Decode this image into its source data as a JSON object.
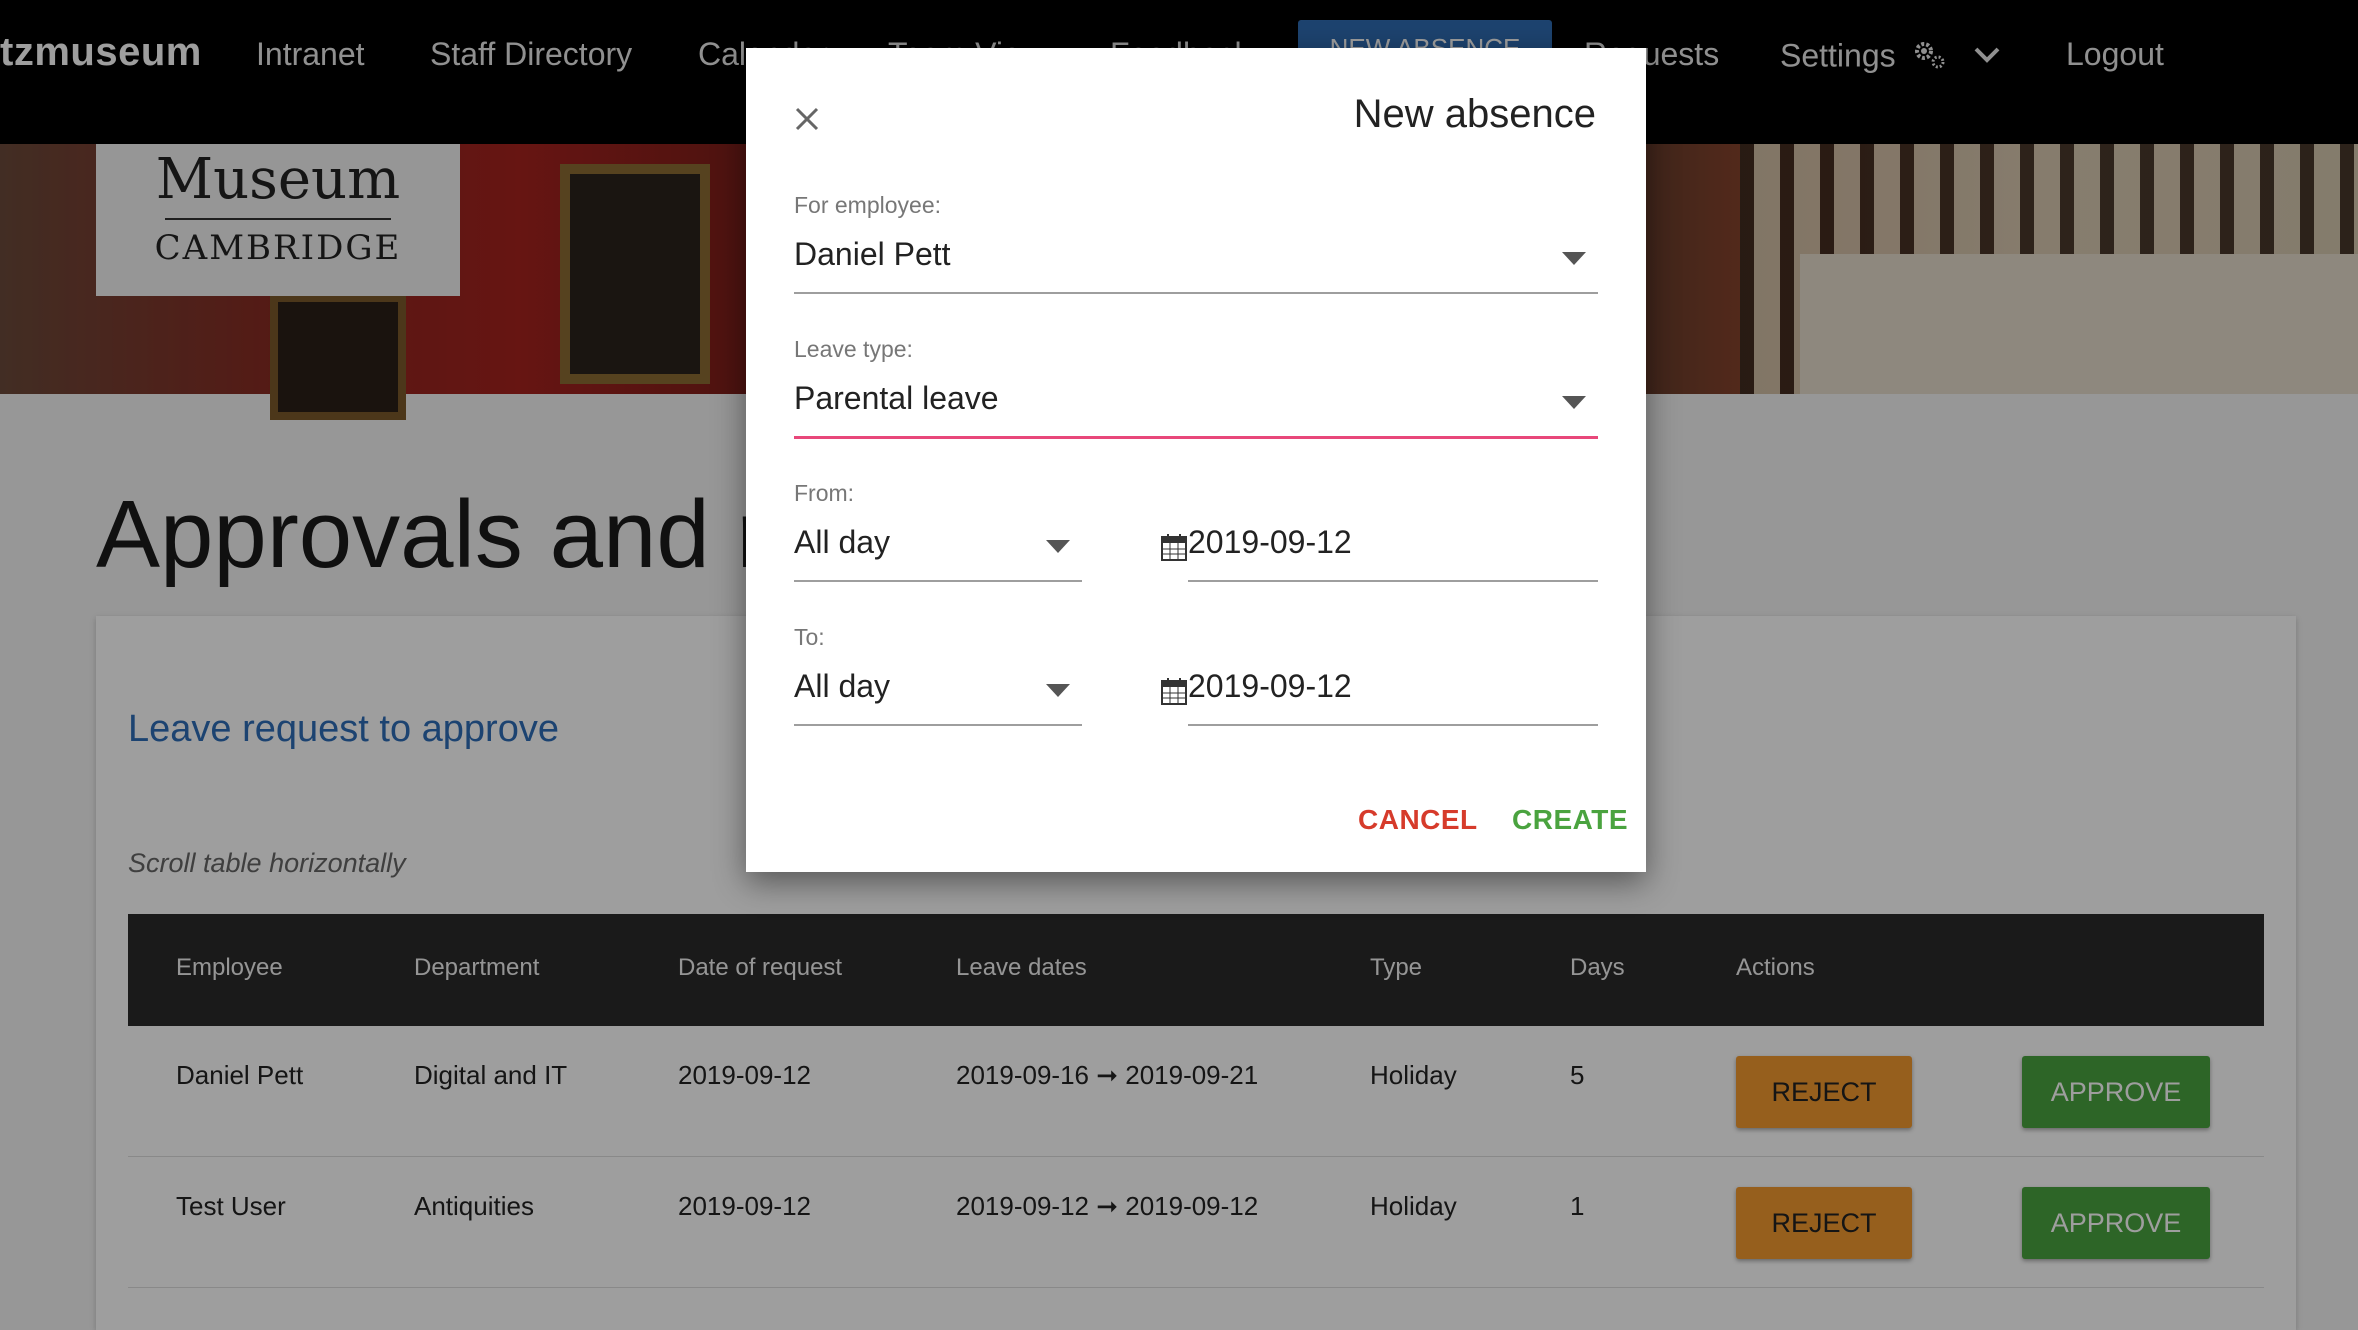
{
  "nav": {
    "brand": "tzmuseum",
    "links": [
      "Intranet",
      "Staff Directory",
      "Calendar",
      "Team View",
      "Feedback"
    ],
    "new_absence_button": "NEW ABSENCE",
    "requests": "Requests",
    "settings": "Settings",
    "logout": "Logout"
  },
  "logo": {
    "line1": "Museum",
    "line2": "CAMBRIDGE"
  },
  "page": {
    "title": "Approvals and requests",
    "card_heading": "Leave request to approve",
    "scroll_hint": "Scroll table horizontally"
  },
  "table": {
    "headers": [
      "Employee",
      "Department",
      "Date of request",
      "Leave dates",
      "Type",
      "Days",
      "Actions"
    ],
    "rows": [
      {
        "employee": "Daniel Pett",
        "department": "Digital and IT",
        "date_of_request": "2019-09-12",
        "leave_dates": "2019-09-16 ➞ 2019-09-21",
        "type": "Holiday",
        "days": "5",
        "reject": "REJECT",
        "approve": "APPROVE"
      },
      {
        "employee": "Test User",
        "department": "Antiquities",
        "date_of_request": "2019-09-12",
        "leave_dates": "2019-09-12 ➞ 2019-09-12",
        "type": "Holiday",
        "days": "1",
        "reject": "REJECT",
        "approve": "APPROVE"
      }
    ]
  },
  "modal": {
    "title": "New absence",
    "employee_label": "For employee:",
    "employee_value": "Daniel Pett",
    "leave_type_label": "Leave type:",
    "leave_type_value": "Parental leave",
    "from_label": "From:",
    "from_period": "All day",
    "from_date": "2019-09-12",
    "to_label": "To:",
    "to_period": "All day",
    "to_date": "2019-09-12",
    "cancel": "CANCEL",
    "create": "CREATE"
  },
  "colors": {
    "primary_blue": "#2e6db6",
    "focus_pink": "#e8477a",
    "reject_orange": "#f39a30",
    "approve_green": "#4aa33f",
    "cancel_red": "#d63b2b"
  }
}
